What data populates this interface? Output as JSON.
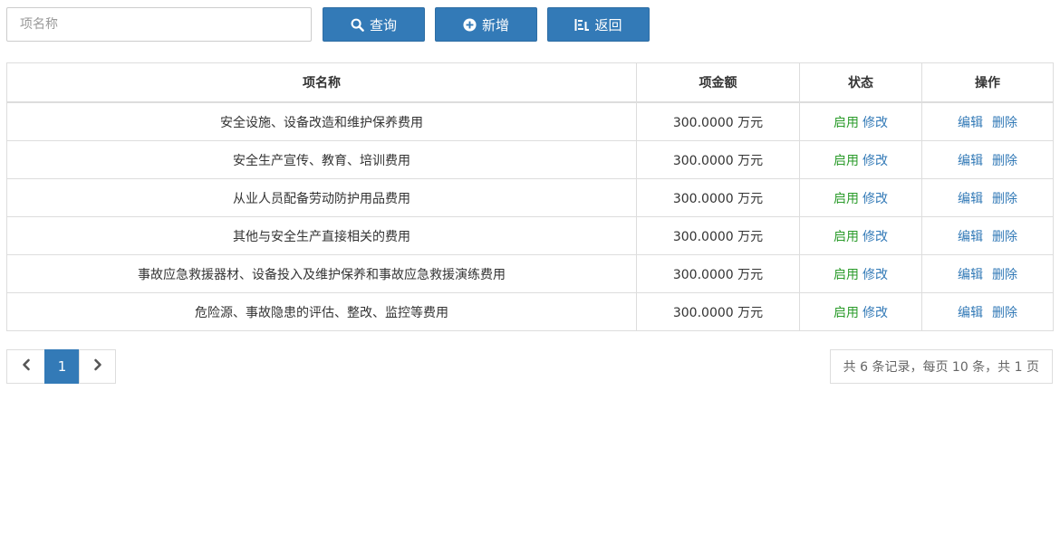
{
  "toolbar": {
    "search_placeholder": "项名称",
    "query_label": "查询",
    "add_label": "新增",
    "back_label": "返回"
  },
  "table": {
    "headers": {
      "name": "项名称",
      "amount": "项金额",
      "status": "状态",
      "ops": "操作"
    },
    "rows": [
      {
        "name": "安全设施、设备改造和维护保养费用",
        "amount": "300.0000 万元",
        "status": "启用",
        "status_action": "修改",
        "edit": "编辑",
        "delete": "删除"
      },
      {
        "name": "安全生产宣传、教育、培训费用",
        "amount": "300.0000 万元",
        "status": "启用",
        "status_action": "修改",
        "edit": "编辑",
        "delete": "删除"
      },
      {
        "name": "从业人员配备劳动防护用品费用",
        "amount": "300.0000 万元",
        "status": "启用",
        "status_action": "修改",
        "edit": "编辑",
        "delete": "删除"
      },
      {
        "name": "其他与安全生产直接相关的费用",
        "amount": "300.0000 万元",
        "status": "启用",
        "status_action": "修改",
        "edit": "编辑",
        "delete": "删除"
      },
      {
        "name": "事故应急救援器材、设备投入及维护保养和事故应急救援演练费用",
        "amount": "300.0000 万元",
        "status": "启用",
        "status_action": "修改",
        "edit": "编辑",
        "delete": "删除"
      },
      {
        "name": "危险源、事故隐患的评估、整改、监控等费用",
        "amount": "300.0000 万元",
        "status": "启用",
        "status_action": "修改",
        "edit": "编辑",
        "delete": "删除"
      }
    ]
  },
  "pagination": {
    "prev_icon": "chevron-left-icon",
    "current_page": "1",
    "next_icon": "chevron-right-icon",
    "records_text": "共 6 条记录，每页 10 条，共 1 页"
  },
  "colors": {
    "primary": "#337ab7",
    "status_green": "#2a9b2a",
    "border": "#dddddd"
  }
}
